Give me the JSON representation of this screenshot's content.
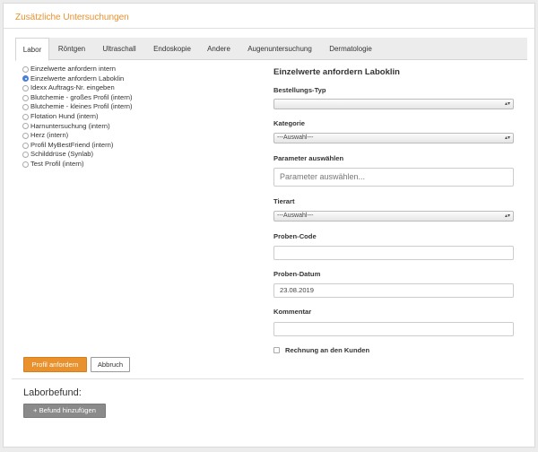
{
  "panel": {
    "title": "Zusätzliche Untersuchungen"
  },
  "tabs": [
    {
      "label": "Labor",
      "active": true
    },
    {
      "label": "Röntgen"
    },
    {
      "label": "Ultraschall"
    },
    {
      "label": "Endoskopie"
    },
    {
      "label": "Andere"
    },
    {
      "label": "Augenuntersuchung"
    },
    {
      "label": "Dermatologie"
    }
  ],
  "options": [
    {
      "label": "Einzelwerte anfordern intern",
      "selected": false
    },
    {
      "label": "Einzelwerte anfordern Laboklin",
      "selected": true
    },
    {
      "label": "Idexx Auftrags-Nr. eingeben",
      "selected": false
    },
    {
      "label": "Blutchemie - großes Profil (intern)",
      "selected": false
    },
    {
      "label": "Blutchemie - kleines Profil (intern)",
      "selected": false
    },
    {
      "label": "Flotation Hund (intern)",
      "selected": false
    },
    {
      "label": "Harnuntersuchung (intern)",
      "selected": false
    },
    {
      "label": "Herz (intern)",
      "selected": false
    },
    {
      "label": "Profil MyBestFriend (intern)",
      "selected": false
    },
    {
      "label": "Schilddrüse (Synlab)",
      "selected": false
    },
    {
      "label": "Test Profil (intern)",
      "selected": false
    }
  ],
  "form": {
    "title": "Einzelwerte anfordern Laboklin",
    "bestellungs_typ": {
      "label": "Bestellungs-Typ",
      "value": ""
    },
    "kategorie": {
      "label": "Kategorie",
      "value": "---Auswahl---"
    },
    "parameter": {
      "label": "Parameter auswählen",
      "placeholder": "Parameter auswählen..."
    },
    "tierart": {
      "label": "Tierart",
      "value": "---Auswahl---"
    },
    "proben_code": {
      "label": "Proben-Code",
      "value": ""
    },
    "proben_datum": {
      "label": "Proben-Datum",
      "value": "23.08.2019"
    },
    "kommentar": {
      "label": "Kommentar",
      "value": ""
    },
    "rechnung": {
      "label": "Rechnung an den Kunden",
      "checked": false
    }
  },
  "actions": {
    "submit": "Profil anfordern",
    "cancel": "Abbruch"
  },
  "laborbefund": {
    "title": "Laborbefund:",
    "add_button": "+ Befund hinzufügen"
  },
  "colors": {
    "accent": "#e8912d",
    "radio_selected": "#4a7fd4",
    "gray_button": "#8a8a8a"
  }
}
